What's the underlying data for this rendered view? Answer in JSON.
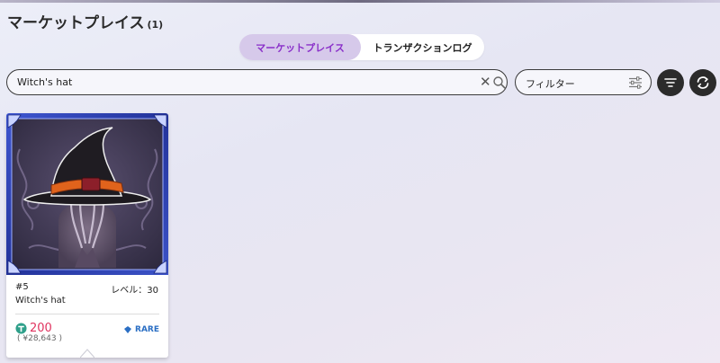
{
  "header": {
    "title": "マーケットプレイス",
    "count": "(1)"
  },
  "tabs": [
    {
      "label": "マーケットプレイス",
      "active": true
    },
    {
      "label": "トランザクションログ",
      "active": false
    }
  ],
  "search": {
    "value": "Witch's hat",
    "clear_glyph": "✕"
  },
  "filter": {
    "label": "フィルター"
  },
  "icons": {
    "search": "search-icon",
    "clear": "close-icon",
    "filter_adjust": "sliders-icon",
    "sort": "filter-lines-icon",
    "refresh": "refresh-icon",
    "currency": "token-coin-icon",
    "rarity": "diamond-icon"
  },
  "colors": {
    "tab_active_bg": "#d6c9ea",
    "tab_active_text": "#8a2fc9",
    "price_text": "#e0335f",
    "rarity_text": "#2b6fc4",
    "token_green": "#2fa08a",
    "card_frame": "#2a3f9e"
  },
  "items": [
    {
      "id": "#5",
      "level": "レベル：30",
      "name": "Witch's hat",
      "price": "200",
      "yen": "( ¥28,643 )",
      "rarity": "RARE"
    }
  ]
}
